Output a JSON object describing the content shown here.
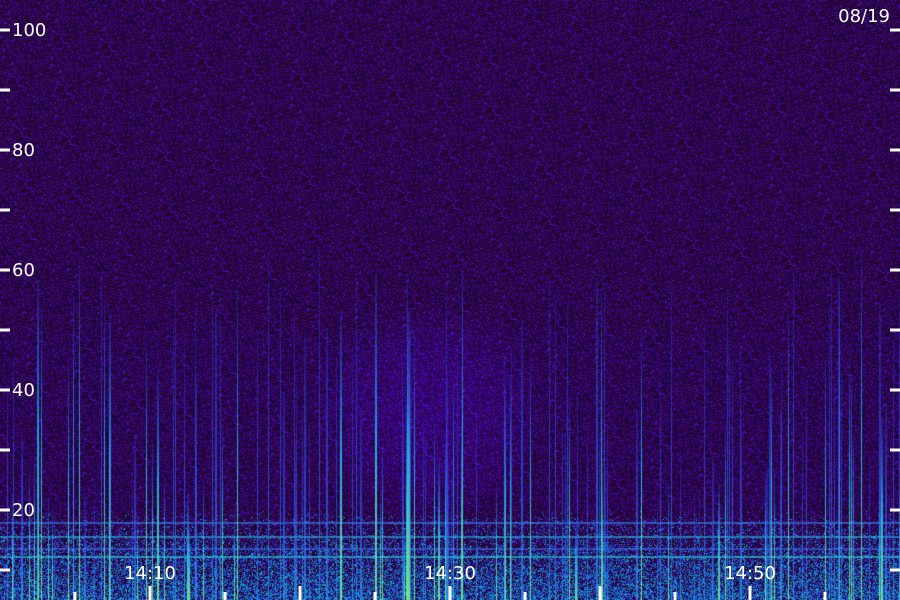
{
  "date": "08/19",
  "chart_data": {
    "type": "heatmap",
    "title": "",
    "xlabel": "",
    "ylabel": "",
    "y_ticks_labeled": [
      20,
      40,
      60,
      80,
      100
    ],
    "y_ticks_all": [
      0,
      10,
      20,
      30,
      40,
      50,
      60,
      70,
      80,
      90,
      100
    ],
    "ylim": [
      0,
      100
    ],
    "x_tick_labels": [
      "14:10",
      "14:30",
      "14:50"
    ],
    "x_tick_minutes": [
      10,
      30,
      50
    ],
    "xlim_minutes": [
      0,
      60
    ],
    "x_minor_tick_step_minutes": 5,
    "colors": {
      "background": "#2a0a3e",
      "low": "#3b0d6b",
      "mid": "#2d3bd6",
      "high": "#19d3e6",
      "peak": "#7af07a",
      "tick": "#ffffff"
    }
  }
}
